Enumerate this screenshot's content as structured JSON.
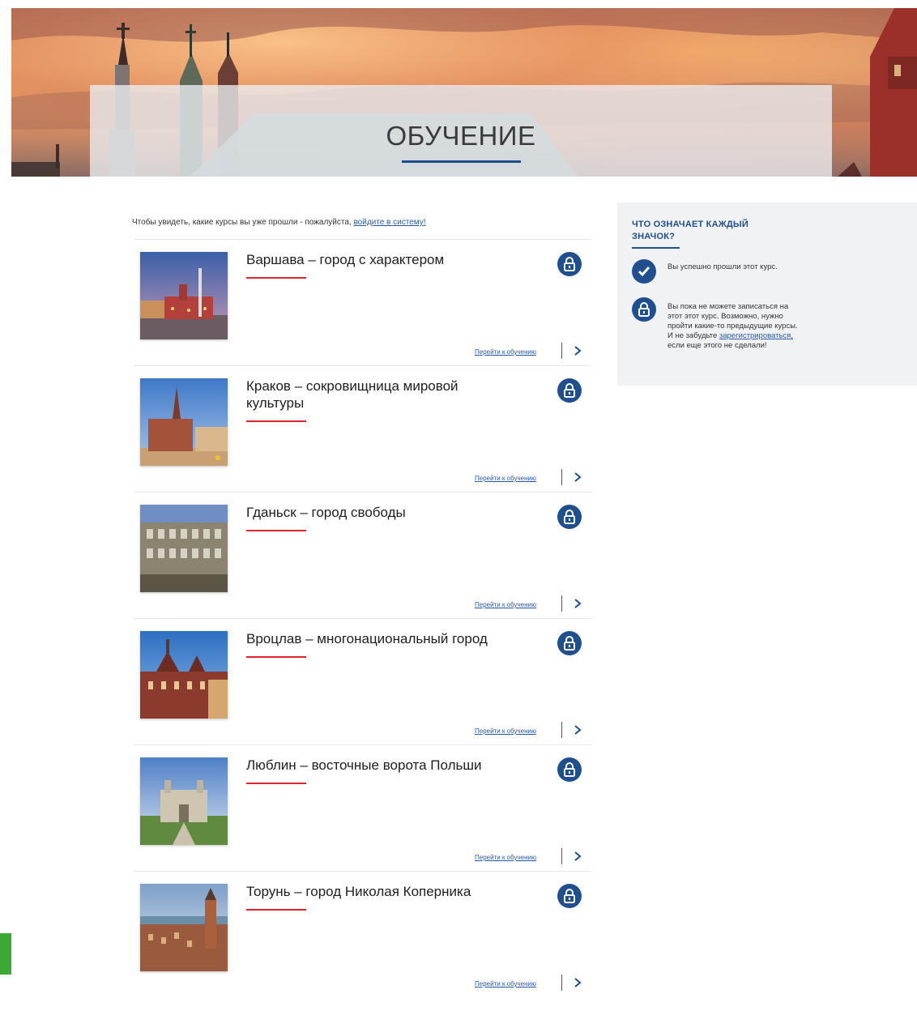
{
  "page": {
    "title": "ОБУЧЕНИЕ"
  },
  "login_note": {
    "prefix": "Чтобы увидеть, какие курсы вы уже прошли - пожалуйста, ",
    "link": "войдите в систему!"
  },
  "courses": [
    {
      "title": "Варшава – город с характером",
      "go_label": "Перейти к обучению",
      "status_icon": "lock-icon",
      "thumb": "warsaw"
    },
    {
      "title": "Краков – сокровищница мировой культуры",
      "go_label": "Перейти к обучению",
      "status_icon": "lock-icon",
      "thumb": "krakow"
    },
    {
      "title": "Гданьск – город свободы",
      "go_label": "Перейти к обучению",
      "status_icon": "lock-icon",
      "thumb": "gdansk"
    },
    {
      "title": "Вроцлав – многонациональный город",
      "go_label": "Перейти к обучению",
      "status_icon": "lock-icon",
      "thumb": "wroclaw"
    },
    {
      "title": "Люблин – восточные ворота Польши",
      "go_label": "Перейти к обучению",
      "status_icon": "lock-icon",
      "thumb": "lublin"
    },
    {
      "title": "Торунь – город Николая Коперника",
      "go_label": "Перейти к обучению",
      "status_icon": "lock-icon",
      "thumb": "torun"
    }
  ],
  "legend": {
    "title": "ЧТО ОЗНАЧАЕТ КАЖДЫЙ ЗНАЧОК?",
    "completed_text": "Вы успешно прошли этот курс.",
    "locked_text_prefix": "Вы пока не можете записаться на этот этот курс. Возможно, нужно пройти какие-то предыдущие курсы. И не забудьте ",
    "locked_link": "зарегистрироваться,",
    "locked_text_suffix": " если еще этого не сделали!"
  },
  "colors": {
    "accent_blue": "#1f4f8f",
    "link_blue": "#2a5aa8",
    "accent_red": "#e2232c",
    "green_tab": "#3aaa35"
  }
}
